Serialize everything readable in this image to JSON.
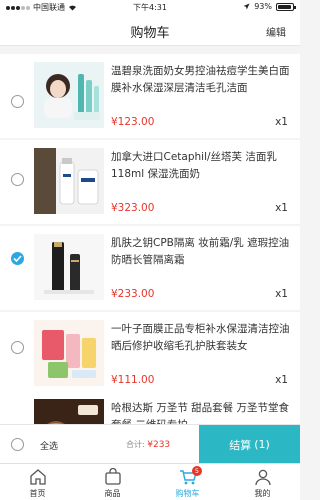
{
  "status_bar": {
    "carrier": "中国联通",
    "time": "下午4:31",
    "battery": "93%",
    "battery_level": 0.93
  },
  "nav": {
    "title": "购物车",
    "edit": "编辑"
  },
  "cart_items": [
    {
      "title": "温碧泉洗面奶女男控油祛痘学生美白面膜补水保湿深层清洁毛孔洁面",
      "price": "¥123.00",
      "qty": "x1",
      "checked": false
    },
    {
      "title": "加拿大进口Cetaphil/丝塔芙 洁面乳118ml 保湿洗面奶",
      "price": "¥323.00",
      "qty": "x1",
      "checked": false
    },
    {
      "title": "肌肤之钥CPB隔离 妆前霜/乳 遮瑕控油防晒长管隔离霜",
      "price": "¥233.00",
      "qty": "x1",
      "checked": true
    },
    {
      "title": "一叶子面膜正品专柜补水保湿清洁控油晒后修护收缩毛孔护肤套装女",
      "price": "¥111.00",
      "qty": "x1",
      "checked": false
    },
    {
      "title": "哈根达斯 万圣节 甜品套餐 万圣节堂食套餐 二维码专拍",
      "price": "",
      "qty": "",
      "checked": false
    }
  ],
  "settle": {
    "select_all": "全选",
    "total_label": "合计:",
    "total_value": "¥233",
    "checkout": "结算",
    "checkout_count": "(1)"
  },
  "tabs": [
    {
      "label": "首页",
      "icon": "home-icon"
    },
    {
      "label": "商品",
      "icon": "bag-icon"
    },
    {
      "label": "购物车",
      "icon": "cart-icon",
      "badge": "5",
      "active": true
    },
    {
      "label": "我的",
      "icon": "user-icon"
    }
  ],
  "colors": {
    "accent": "#2ba8e0",
    "checkout": "#2bb8c4",
    "price": "#e8352a"
  }
}
